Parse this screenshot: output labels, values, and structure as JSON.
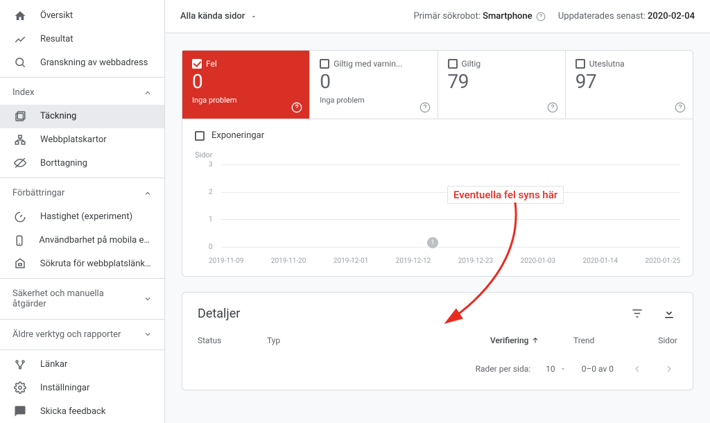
{
  "sidebar": {
    "top": [
      {
        "label": "Översikt"
      },
      {
        "label": "Resultat"
      },
      {
        "label": "Granskning av webbadress"
      }
    ],
    "groups": {
      "index": {
        "label": "Index"
      },
      "improve": {
        "label": "Förbättringar"
      },
      "security": {
        "label": "Säkerhet och manuella åtgärder"
      },
      "legacy": {
        "label": "Äldre verktyg och rapporter"
      }
    },
    "index_items": [
      {
        "label": "Täckning"
      },
      {
        "label": "Webbplatskartor"
      },
      {
        "label": "Borttagning"
      }
    ],
    "improve_items": [
      {
        "label": "Hastighet (experiment)"
      },
      {
        "label": "Användbarhet på mobila enh..."
      },
      {
        "label": "Sökruta för webbplatslänkar"
      }
    ],
    "bottom": [
      {
        "label": "Länkar"
      },
      {
        "label": "Inställningar"
      },
      {
        "label": "Skicka feedback"
      }
    ]
  },
  "topbar": {
    "filter_label": "Alla kända sidor",
    "robot_label": "Primär sökrobot:",
    "robot_value": "Smartphone",
    "updated_label": "Uppdaterades senast:",
    "updated_value": "2020-02-04"
  },
  "metrics": [
    {
      "title": "Fel",
      "value": "0",
      "sub": "Inga problem"
    },
    {
      "title": "Giltig med varnin...",
      "value": "0",
      "sub": "Inga problem"
    },
    {
      "title": "Giltig",
      "value": "79",
      "sub": ""
    },
    {
      "title": "Uteslutna",
      "value": "97",
      "sub": ""
    }
  ],
  "chart": {
    "impressions_label": "Exponeringar",
    "yaxis_label": "Sidor",
    "event_badge": "1"
  },
  "chart_data": {
    "type": "line",
    "title": "",
    "xlabel": "",
    "ylabel": "Sidor",
    "ylim": [
      0,
      3
    ],
    "yticks": [
      3,
      2,
      1,
      0
    ],
    "categories": [
      "2019-11-09",
      "2019-11-20",
      "2019-12-01",
      "2019-12-12",
      "2019-12-23",
      "2020-01-03",
      "2020-01-14",
      "2020-01-25"
    ],
    "series": [
      {
        "name": "Fel",
        "values": [
          0,
          0,
          0,
          0,
          0,
          0,
          0,
          0
        ]
      }
    ]
  },
  "details": {
    "title": "Detaljer",
    "columns": {
      "status": "Status",
      "type": "Typ",
      "verification": "Verifiering",
      "trend": "Trend",
      "pages": "Sidor"
    },
    "footer": {
      "rows_label": "Rader per sida:",
      "rows_value": "10",
      "range": "0–0 av 0"
    }
  },
  "annotation": {
    "text": "Eventuella fel syns här"
  }
}
